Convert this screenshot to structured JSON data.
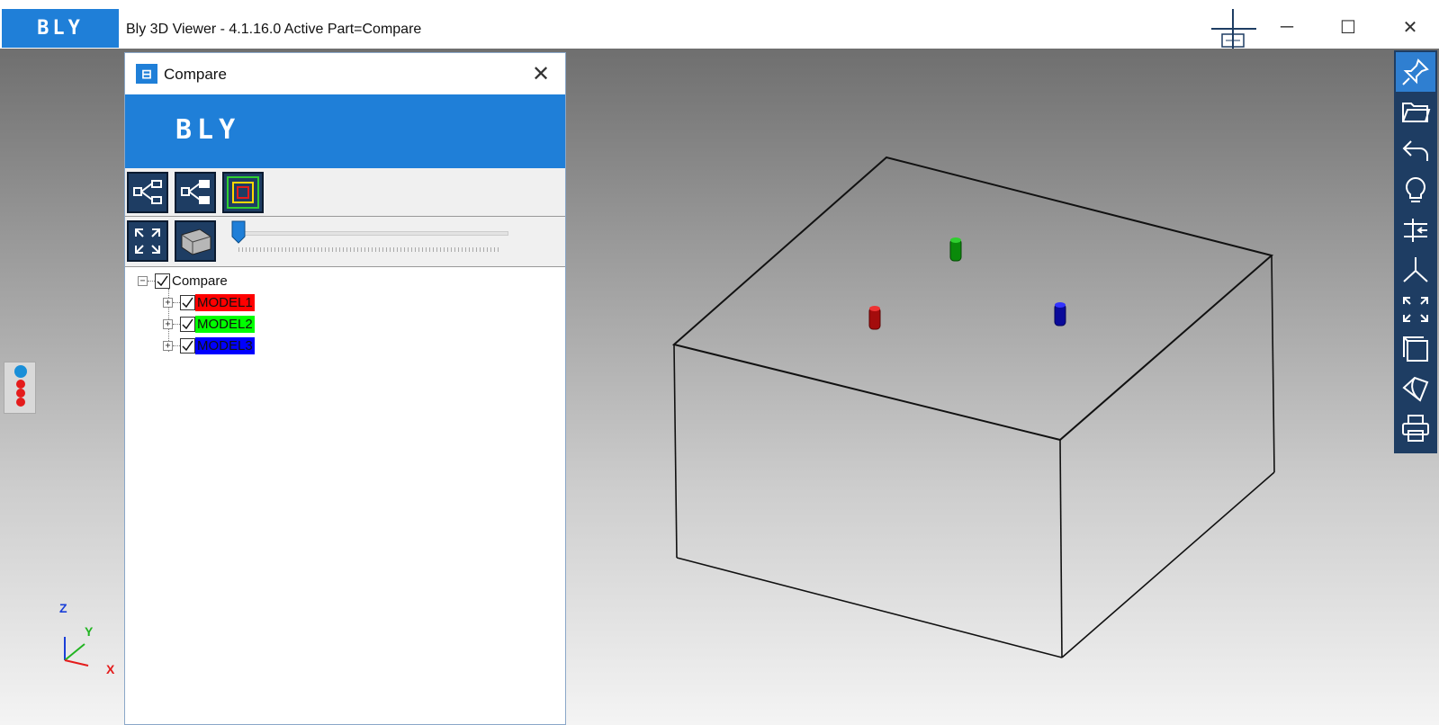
{
  "app": {
    "logo_text": "BLY",
    "title": "Bly 3D Viewer - 4.1.16.0 Active Part=Compare"
  },
  "window_controls": {
    "minimize": "─",
    "maximize": "☐",
    "close": "✕"
  },
  "compare_panel": {
    "icon_text": "⊟",
    "title": "Compare",
    "close": "✕",
    "banner_logo": "BLY",
    "tree": {
      "root": {
        "label": "Compare",
        "checked": true,
        "expander": "−"
      },
      "children": [
        {
          "label": "MODEL1",
          "color": "#ff0000",
          "checked": true,
          "expander": "+"
        },
        {
          "label": "MODEL2",
          "color": "#00ff00",
          "checked": true,
          "expander": "+"
        },
        {
          "label": "MODEL3",
          "color": "#0000ff",
          "checked": true,
          "expander": "+"
        }
      ]
    }
  },
  "right_toolbar": {
    "icons": [
      "pin-icon",
      "folder-open-icon",
      "undo-icon",
      "lightbulb-icon",
      "split-icon",
      "axis-icon",
      "fit-view-icon",
      "box-view-icon",
      "shape-icon",
      "print-icon"
    ]
  },
  "axes": {
    "x": "X",
    "y": "Y",
    "z": "Z"
  },
  "colors": {
    "accent": "#1f7fd8",
    "toolbar": "#1e3d63"
  }
}
